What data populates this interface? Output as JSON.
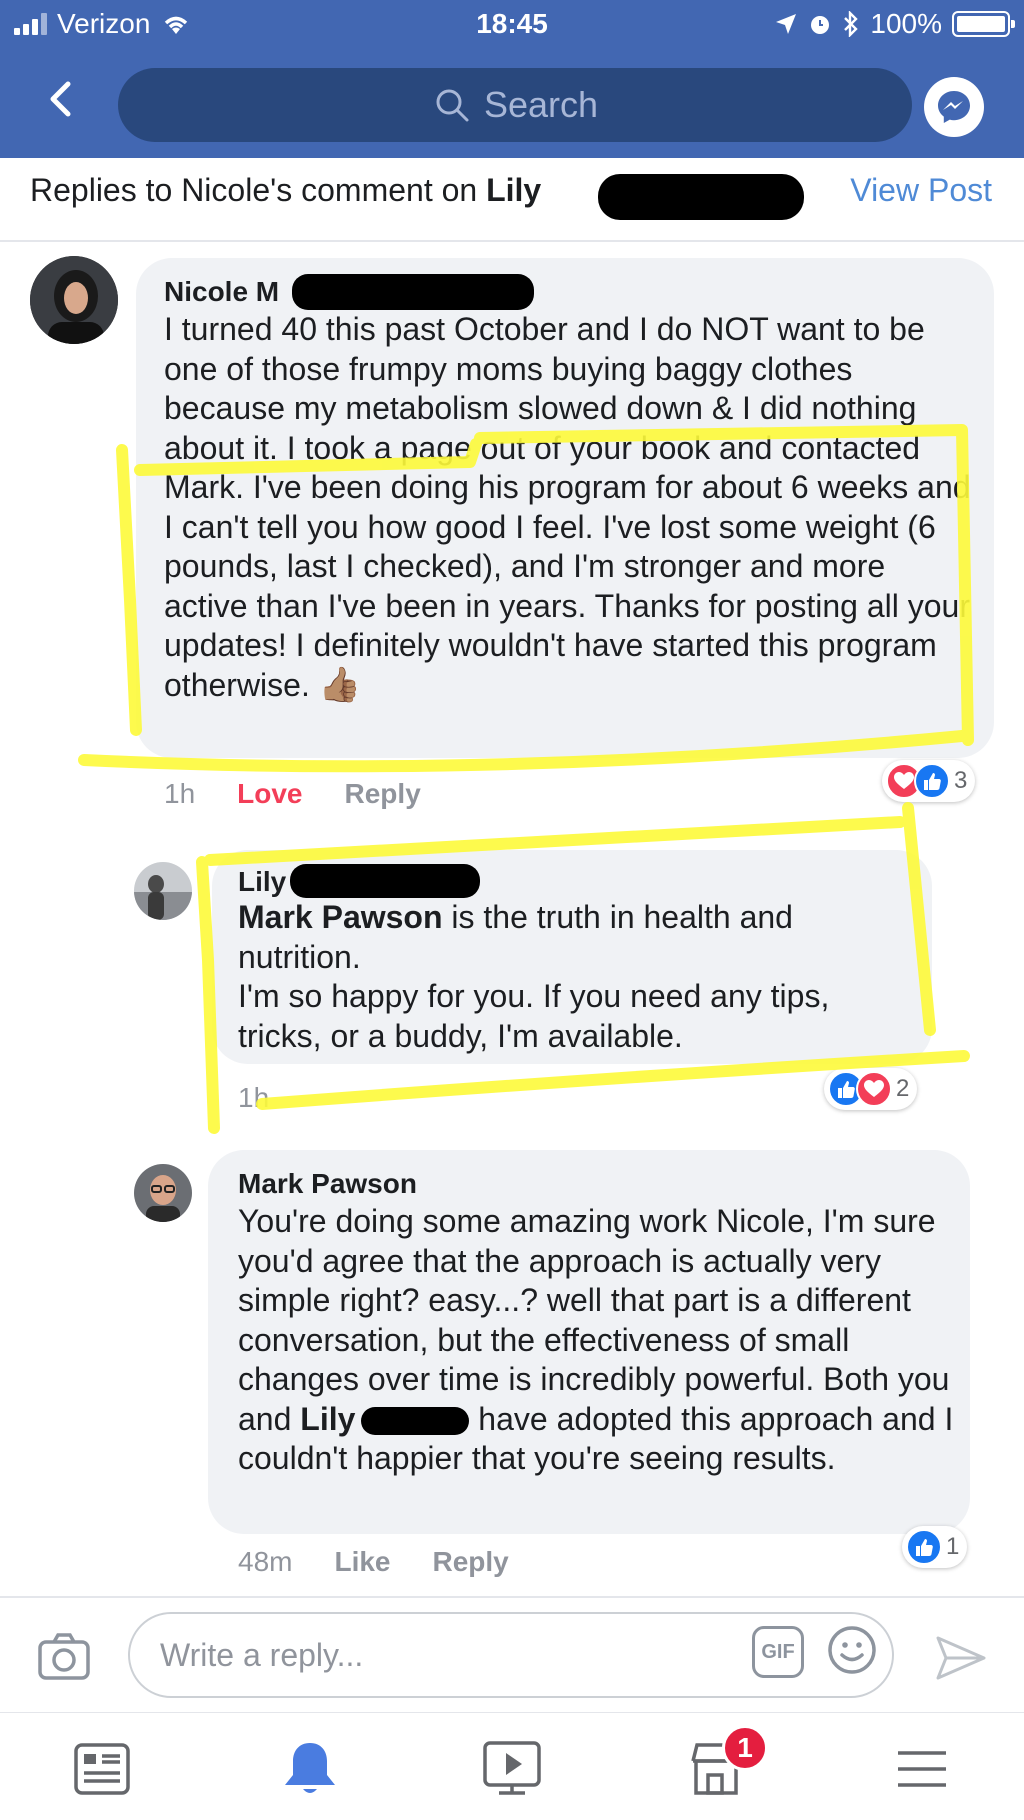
{
  "status_bar": {
    "carrier": "Verizon",
    "time": "18:45",
    "battery": "100%",
    "icons": [
      "signal-icon",
      "wifi-icon",
      "location-icon",
      "alarm-icon",
      "bluetooth-icon",
      "battery-icon"
    ]
  },
  "nav": {
    "search_placeholder": "Search"
  },
  "replies_header": {
    "prefix": "Replies to Nicole's comment on ",
    "name": "Lily",
    "view_post": "View Post"
  },
  "comments": [
    {
      "author": "Nicole M",
      "text": "I turned 40 this past October and I do NOT want to be one of those frumpy moms buying baggy clothes because my metabolism slowed down & I did nothing about it. I took a page out of your book and contacted Mark. I've been doing his program for about 6 weeks and I can't tell you how good I feel. I've lost some weight (6 pounds, last I checked), and I'm stronger and more active than I've been in years. Thanks for posting all your updates! I definitely wouldn't have started this program otherwise.",
      "emoji": "👍🏽",
      "time": "1h",
      "love": "Love",
      "reply": "Reply",
      "reaction_count": "3"
    },
    {
      "author": "Lily",
      "mention": "Mark Pawson",
      "text_after_mention": " is the truth in health and nutrition.",
      "text_line2": "I'm so happy for you. If you need any tips, tricks, or a buddy, I'm available.",
      "time": "1h",
      "reaction_count": "2"
    },
    {
      "author": "Mark Pawson",
      "text_before_mention": "You're doing some amazing work Nicole, I'm sure you'd agree that the approach is actually very simple right? easy...? well that part is a different conversation, but the effectiveness of small changes over time is incredibly powerful. Both you and ",
      "mention": "Lily",
      "text_after_mention": " have adopted this approach and I couldn't happier that you're seeing results.",
      "time": "48m",
      "like": "Like",
      "reply": "Reply",
      "reaction_count": "1"
    }
  ],
  "composer": {
    "placeholder": "Write a reply...",
    "gif": "GIF"
  },
  "tab_bar": {
    "tabs": [
      "news-feed-tab",
      "notifications-tab",
      "watch-tab",
      "marketplace-tab",
      "menu-tab"
    ],
    "marketplace_badge": "1"
  },
  "colors": {
    "header_blue": "#4267b2",
    "search_dark": "#29487d",
    "link_blue": "#4f8ad6",
    "love_red": "#f33e58",
    "like_blue": "#1877f2",
    "highlighter": "#fdfa3a",
    "bubble_gray": "#f0f2f5"
  }
}
